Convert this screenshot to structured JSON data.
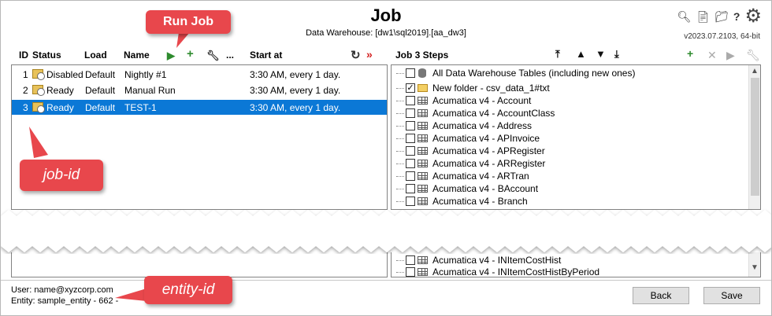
{
  "header": {
    "title": "Job",
    "subtitle": "Data Warehouse: [dw1\\sql2019].[aa_dw3]",
    "version": "v2023.07.2103, 64-bit",
    "icons": [
      "search-icon",
      "document-icon",
      "folder-icon",
      "help-icon",
      "gear-icon"
    ]
  },
  "job_table": {
    "columns": [
      "ID",
      "Status",
      "Load",
      "Name",
      "Start at"
    ],
    "toolbar": {
      "more_label": "..."
    },
    "rows": [
      {
        "id": "1",
        "status": "Disabled",
        "load": "Default",
        "name": "Nightly #1",
        "start": "3:30 AM, every 1 day.",
        "selected": false
      },
      {
        "id": "2",
        "status": "Ready",
        "load": "Default",
        "name": "Manual Run",
        "start": "3:30 AM, every 1 day.",
        "selected": false
      },
      {
        "id": "3",
        "status": "Ready",
        "load": "Default",
        "name": "TEST-1",
        "start": "3:30 AM, every 1 day.",
        "selected": true
      }
    ]
  },
  "steps": {
    "header": "Job 3 Steps",
    "items": [
      {
        "label": "All Data Warehouse Tables (including new ones)",
        "icon": "database-icon",
        "checked": false
      },
      {
        "label": "New folder - csv_data_1#txt",
        "icon": "folder-icon",
        "checked": true
      },
      {
        "label": "Acumatica v4 - Account",
        "icon": "table-icon",
        "checked": false
      },
      {
        "label": "Acumatica v4 - AccountClass",
        "icon": "table-icon",
        "checked": false
      },
      {
        "label": "Acumatica v4 - Address",
        "icon": "table-icon",
        "checked": false
      },
      {
        "label": "Acumatica v4 - APInvoice",
        "icon": "table-icon",
        "checked": false
      },
      {
        "label": "Acumatica v4 - APRegister",
        "icon": "table-icon",
        "checked": false
      },
      {
        "label": "Acumatica v4 - ARRegister",
        "icon": "table-icon",
        "checked": false
      },
      {
        "label": "Acumatica v4 - ARTran",
        "icon": "table-icon",
        "checked": false
      },
      {
        "label": "Acumatica v4 - BAccount",
        "icon": "table-icon",
        "checked": false
      },
      {
        "label": "Acumatica v4 - Branch",
        "icon": "table-icon",
        "checked": false
      }
    ],
    "lower_items": [
      {
        "label": "Acumatica v4 - INItemCostHist",
        "icon": "table-icon",
        "checked": false
      },
      {
        "label": "Acumatica v4 - INItemCostHistByPeriod",
        "icon": "table-icon",
        "checked": false
      }
    ]
  },
  "footer": {
    "user": "User:  name@xyzcorp.com",
    "entity": "Entity: sample_entity - 662 -",
    "back_label": "Back",
    "save_label": "Save"
  },
  "callouts": {
    "run_job": "Run Job",
    "job_id": "job-id",
    "entity_id": "entity-id"
  },
  "colors": {
    "selection": "#0b78d6",
    "callout": "#e8474c",
    "green": "#2e8b2e",
    "red": "#d42020"
  }
}
